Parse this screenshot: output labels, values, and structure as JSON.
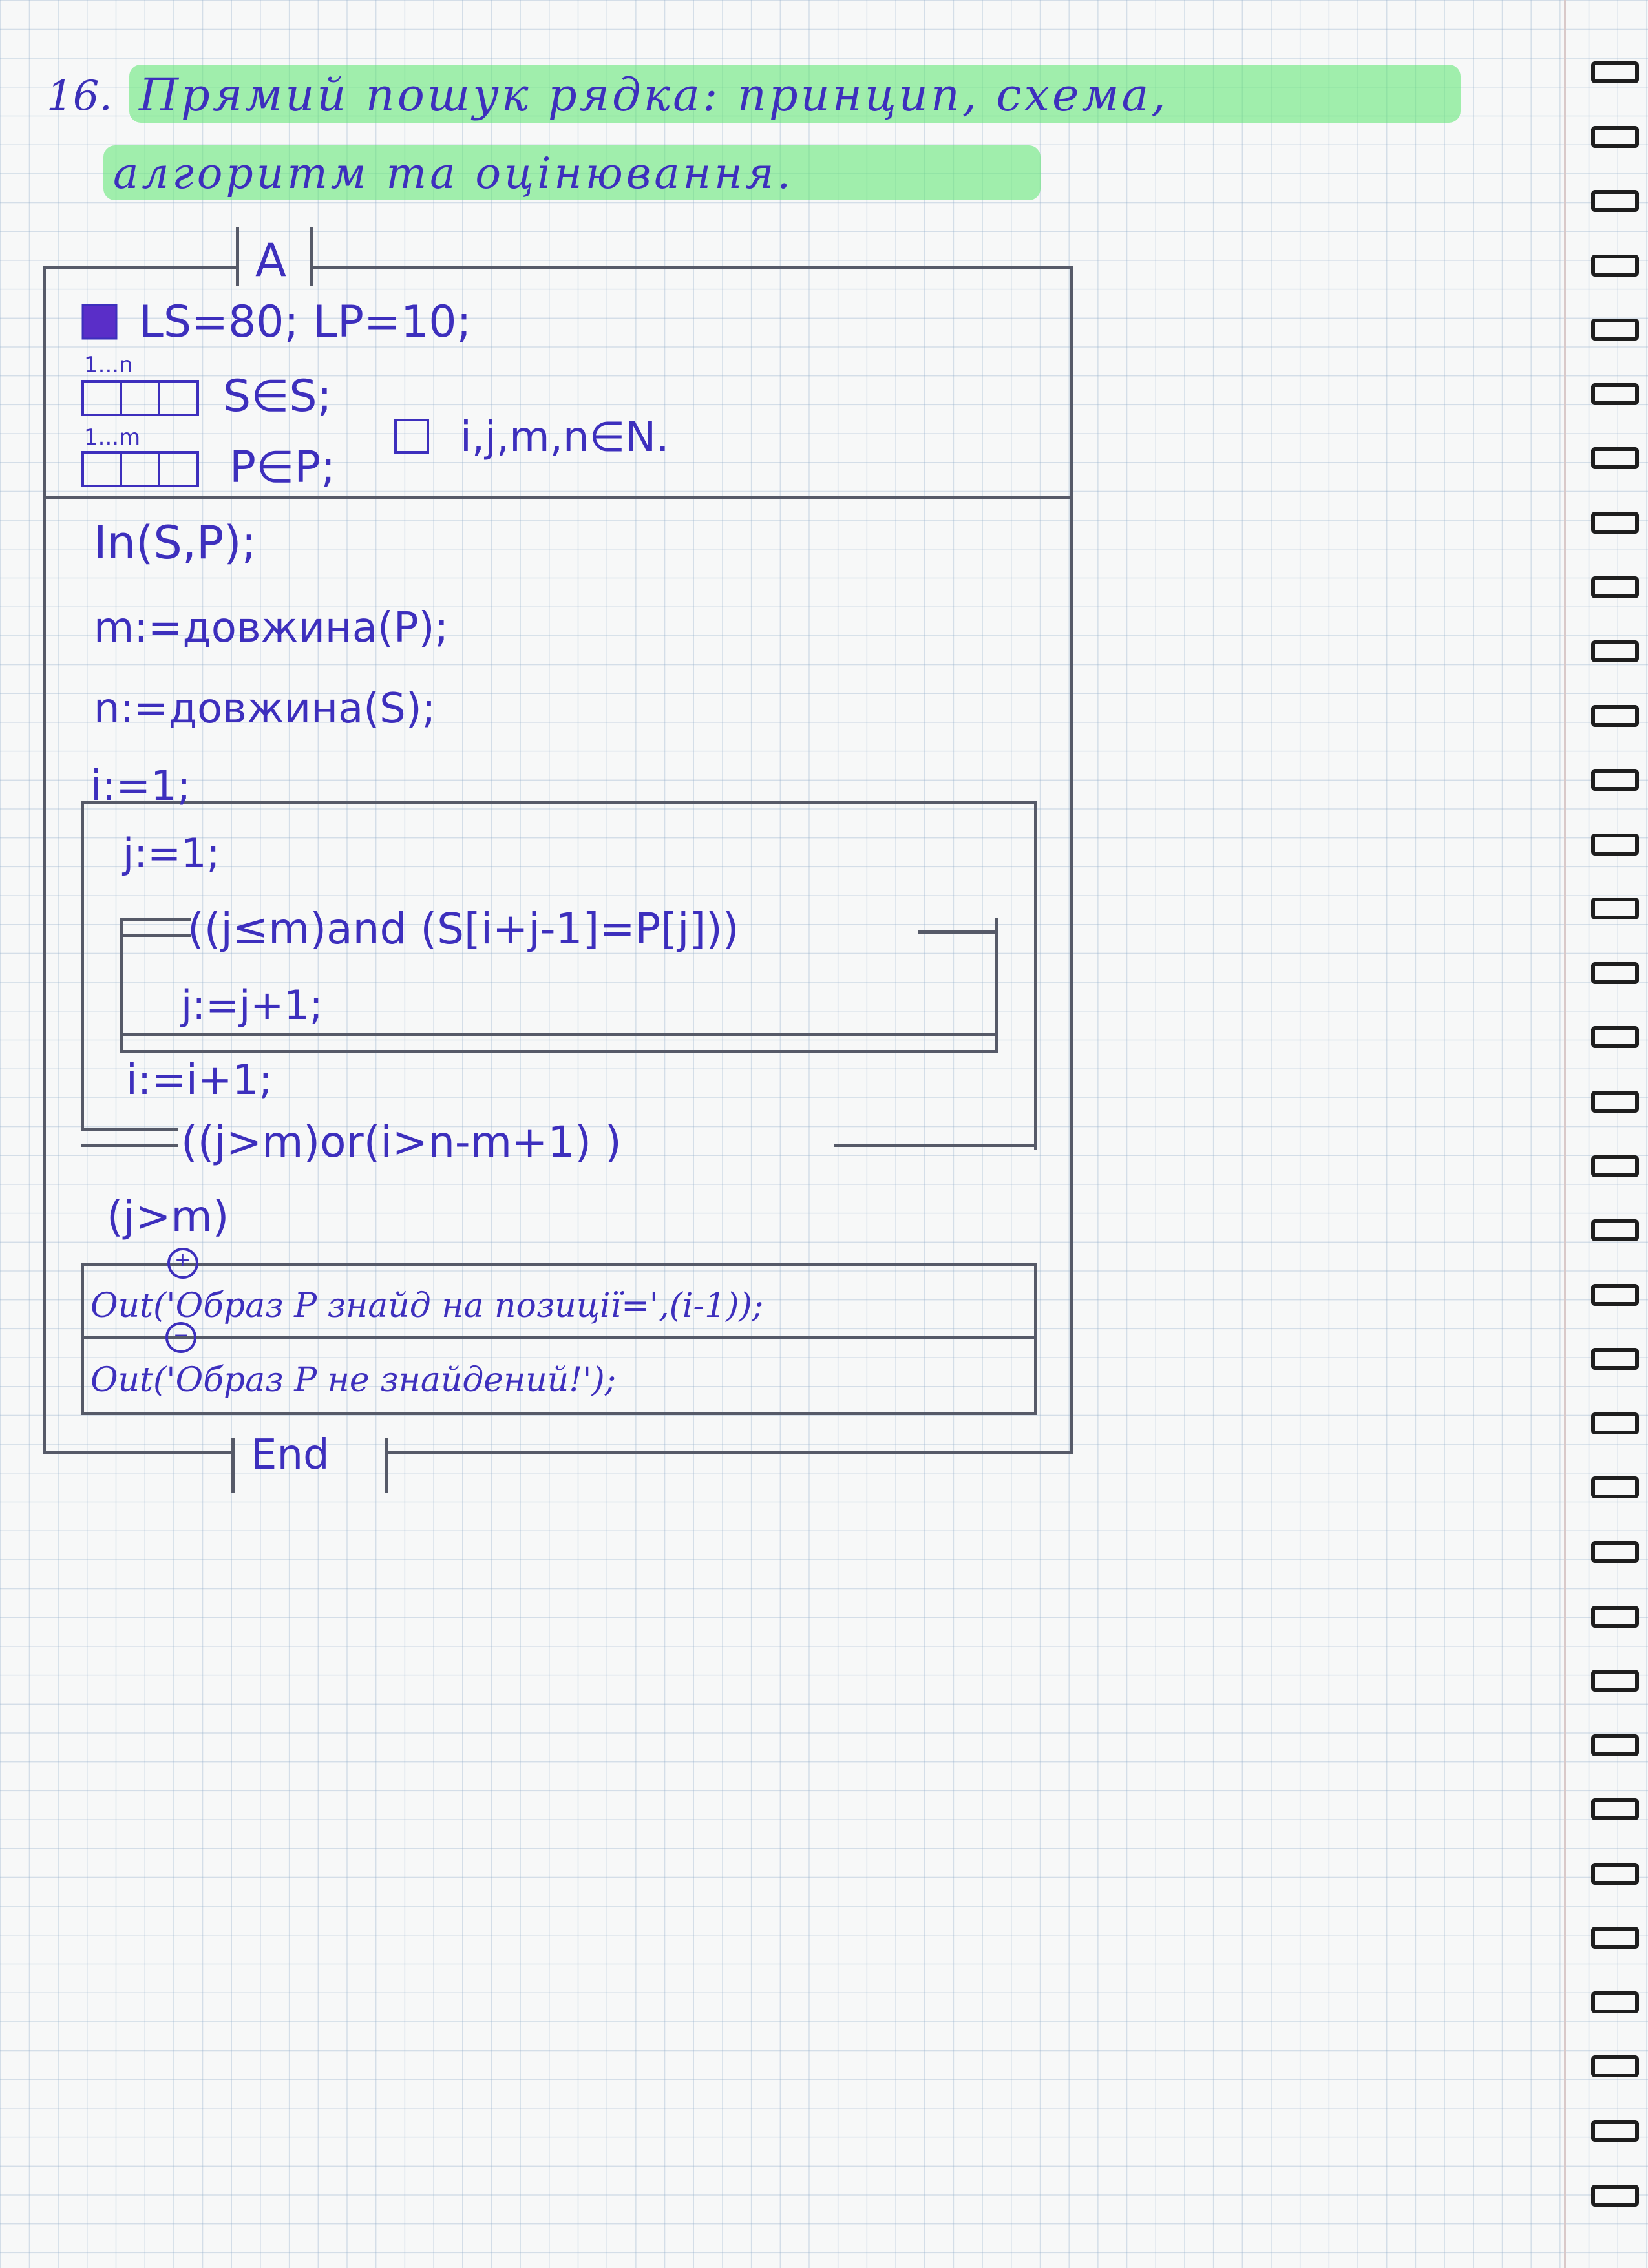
{
  "task": {
    "number": "16.",
    "title_line1": "Прямий пошук рядка: принцип, схема,",
    "title_line2": "алгоритм та оцінювання."
  },
  "diagram": {
    "start_label": "A",
    "end_label": "End",
    "declarations": {
      "ls_lp": "LS=80; LP=10;",
      "array_s_range": "1...n",
      "array_s": "S∈S;",
      "array_p_range": "1...m",
      "array_p": "P∈P;",
      "vars": "i,j,m,n∈N."
    },
    "body": {
      "input": "In(S,P);",
      "m_assign": "m:=довжина(P);",
      "n_assign": "n:=довжина(S);",
      "i_init": "i:=1;",
      "j_init": "j:=1;",
      "inner_cond": "((j≤m)and (S[i+j-1]=P[j]))",
      "j_inc": "j:=j+1;",
      "i_inc": "i:=i+1;",
      "outer_cond": "((j>m)or(i>n-m+1)  )",
      "if_cond": "(j>m)",
      "plus_mark": "+",
      "minus_mark": "−",
      "out_found": "Out('Образ P знайд на позиції=',(i-1));",
      "out_notfound": "Out('Образ P не знайдений!');"
    }
  }
}
